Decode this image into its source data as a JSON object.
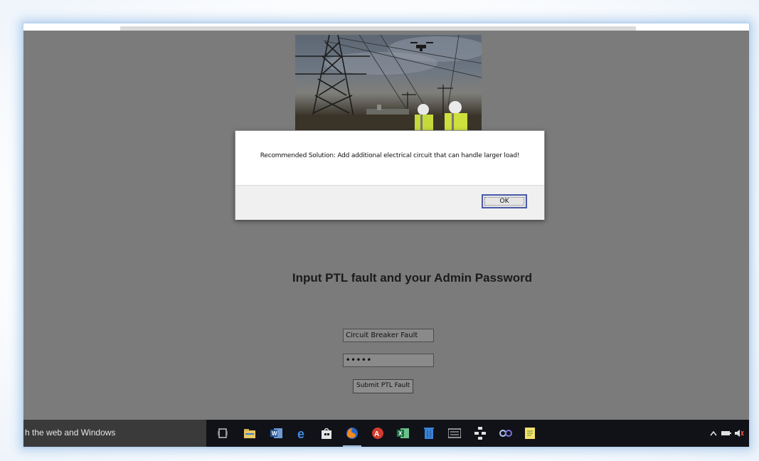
{
  "page": {
    "heading": "Input PTL fault and your Admin Password",
    "fault_input": {
      "value": "Circuit Breaker Fault"
    },
    "password_input": {
      "value": "•••••"
    },
    "submit_label": "Submit PTL Fault"
  },
  "alert": {
    "message": "Recommended Solution: Add additional electrical circuit that can handle larger load!",
    "ok_label": "OK"
  },
  "taskbar": {
    "search_text": "h the web and Windows",
    "apps": [
      {
        "name": "task-view-icon"
      },
      {
        "name": "file-explorer-icon"
      },
      {
        "name": "word-icon"
      },
      {
        "name": "edge-icon"
      },
      {
        "name": "store-icon"
      },
      {
        "name": "firefox-icon"
      },
      {
        "name": "acrobat-icon"
      },
      {
        "name": "excel-icon"
      },
      {
        "name": "recycle-icon"
      },
      {
        "name": "keyboard-icon"
      },
      {
        "name": "network-diagram-icon"
      },
      {
        "name": "link-icon"
      },
      {
        "name": "notepad-icon"
      }
    ],
    "tray": [
      {
        "name": "chevron-up-icon"
      },
      {
        "name": "battery-icon"
      },
      {
        "name": "volume-icon"
      }
    ]
  }
}
